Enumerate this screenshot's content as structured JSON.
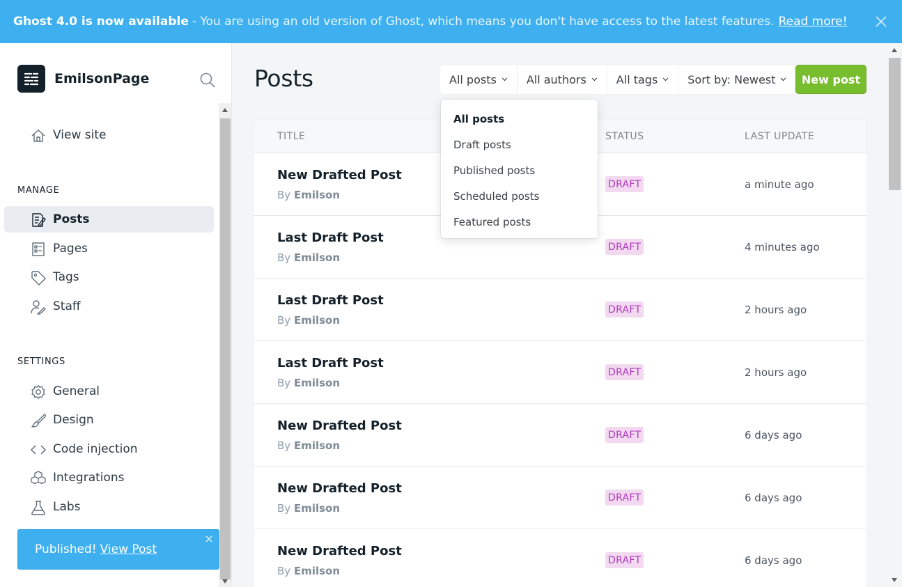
{
  "banner": {
    "strong": "Ghost 4.0 is now available",
    "text": "- You are using an old version of Ghost, which means you don't have access to the latest features.",
    "link": "Read more!"
  },
  "sidebar": {
    "brand_name": "EmilsonPage",
    "view_site": "View site",
    "manage_heading": "MANAGE",
    "manage_items": [
      {
        "label": "Posts",
        "icon": "posts-icon",
        "active": true
      },
      {
        "label": "Pages",
        "icon": "pages-icon",
        "active": false
      },
      {
        "label": "Tags",
        "icon": "tag-icon",
        "active": false
      },
      {
        "label": "Staff",
        "icon": "staff-icon",
        "active": false
      }
    ],
    "settings_heading": "SETTINGS",
    "settings_items": [
      {
        "label": "General",
        "icon": "gear-icon"
      },
      {
        "label": "Design",
        "icon": "brush-icon"
      },
      {
        "label": "Code injection",
        "icon": "code-icon"
      },
      {
        "label": "Integrations",
        "icon": "integrations-icon"
      },
      {
        "label": "Labs",
        "icon": "flask-icon"
      }
    ]
  },
  "toast": {
    "text": "Published!",
    "link": "View Post"
  },
  "main": {
    "title": "Posts",
    "filters": [
      "All posts",
      "All authors",
      "All tags",
      "Sort by: Newest"
    ],
    "new_post": "New post",
    "dropdown": [
      "All posts",
      "Draft posts",
      "Published posts",
      "Scheduled posts",
      "Featured posts"
    ],
    "columns": [
      "TITLE",
      "STATUS",
      "LAST UPDATE"
    ],
    "by_prefix": "By",
    "posts": [
      {
        "title": "New Drafted Post",
        "author": "Emilson",
        "status": "DRAFT",
        "updated": "a minute ago"
      },
      {
        "title": "Last Draft Post",
        "author": "Emilson",
        "status": "DRAFT",
        "updated": "4 minutes ago"
      },
      {
        "title": "Last Draft Post",
        "author": "Emilson",
        "status": "DRAFT",
        "updated": "2 hours ago"
      },
      {
        "title": "Last Draft Post",
        "author": "Emilson",
        "status": "DRAFT",
        "updated": "2 hours ago"
      },
      {
        "title": "New Drafted Post",
        "author": "Emilson",
        "status": "DRAFT",
        "updated": "6 days ago"
      },
      {
        "title": "New Drafted Post",
        "author": "Emilson",
        "status": "DRAFT",
        "updated": "6 days ago"
      },
      {
        "title": "New Drafted Post",
        "author": "Emilson",
        "status": "DRAFT",
        "updated": "6 days ago"
      }
    ]
  },
  "colors": {
    "accent_blue": "#3eb0ef",
    "new_post_green": "#78bd2e",
    "draft_badge_bg": "#f2d9f0",
    "draft_badge_text": "#b03cbf"
  }
}
